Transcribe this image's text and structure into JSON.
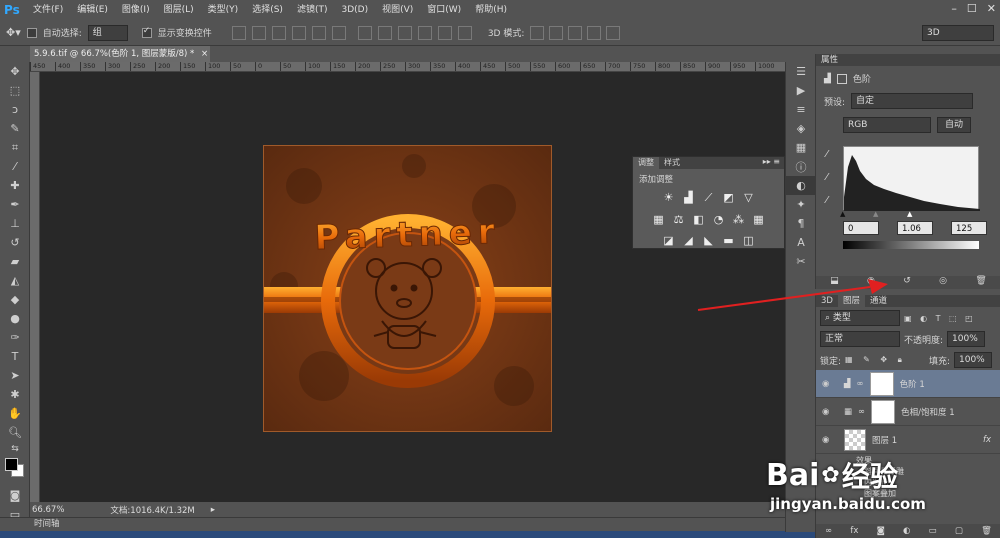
{
  "app": {
    "logo": "Ps"
  },
  "menu": [
    "文件(F)",
    "编辑(E)",
    "图像(I)",
    "图层(L)",
    "类型(Y)",
    "选择(S)",
    "滤镜(T)",
    "3D(D)",
    "视图(V)",
    "窗口(W)",
    "帮助(H)"
  ],
  "window_buttons": [
    "–",
    "☐",
    "✕"
  ],
  "options": {
    "auto_select_label": "自动选择:",
    "auto_select_value": "组",
    "show_transform_label": "显示变换控件",
    "mode_3d_label": "3D 模式:",
    "workspace_value": "3D"
  },
  "document": {
    "tab_title": "5.9.6.tif @ 66.7%(色阶 1, 图层蒙版/8) *",
    "close_icon": "×"
  },
  "ruler": {
    "ticks": [
      "450",
      "400",
      "350",
      "300",
      "250",
      "200",
      "150",
      "100",
      "50",
      "0",
      "50",
      "100",
      "150",
      "200",
      "250",
      "300",
      "350",
      "400",
      "450",
      "500",
      "550",
      "600",
      "650",
      "700",
      "750",
      "800",
      "850",
      "900",
      "950",
      "1000"
    ]
  },
  "artwork": {
    "text": "Partner"
  },
  "status": {
    "zoom": "66.67%",
    "doc_info": "文档:1016.4K/1.32M"
  },
  "timeline": {
    "label": "时间轴"
  },
  "adjustments_panel": {
    "tabs": [
      "调整",
      "样式"
    ],
    "heading": "添加调整",
    "row1_icons": [
      "brightness-icon",
      "levels-icon",
      "curves-icon",
      "exposure-icon",
      "vibrance-icon"
    ],
    "row2_icons": [
      "hue-saturation-icon",
      "color-balance-icon",
      "black-white-icon",
      "photo-filter-icon",
      "channel-mixer-icon",
      "color-lookup-icon"
    ],
    "row3_icons": [
      "invert-icon",
      "posterize-icon",
      "threshold-icon",
      "gradient-map-icon",
      "selective-color-icon"
    ]
  },
  "properties": {
    "tab": "属性",
    "title": "色阶",
    "preset_label": "预设:",
    "preset_value": "自定",
    "channel_value": "RGB",
    "auto_label": "自动",
    "input_black": "0",
    "input_gamma": "1.06",
    "input_white": "125"
  },
  "layers_panel": {
    "tabs": [
      "3D",
      "图层",
      "通道"
    ],
    "filter_label": "类型",
    "blend_mode": "正常",
    "opacity_label": "不透明度:",
    "opacity_value": "100%",
    "lock_label": "锁定:",
    "fill_label": "填充:",
    "fill_value": "100%",
    "layers": [
      {
        "name": "色阶 1",
        "selected": true
      },
      {
        "name": "色相/饱和度 1",
        "selected": false
      },
      {
        "name": "图层 1",
        "selected": false
      }
    ],
    "effects_label": "效果",
    "effects": [
      "斜面和浮雕",
      "内发光",
      "图案叠加"
    ],
    "fx": "fx"
  },
  "watermark": {
    "brand": "Bai",
    "brand2": "经验",
    "url": "jingyan.baidu.com"
  },
  "colors": {
    "bg": "#535353",
    "canvas": "#282828",
    "accent": "#31a8ff",
    "arrow": "#e02020",
    "orange": "#e8640a"
  }
}
